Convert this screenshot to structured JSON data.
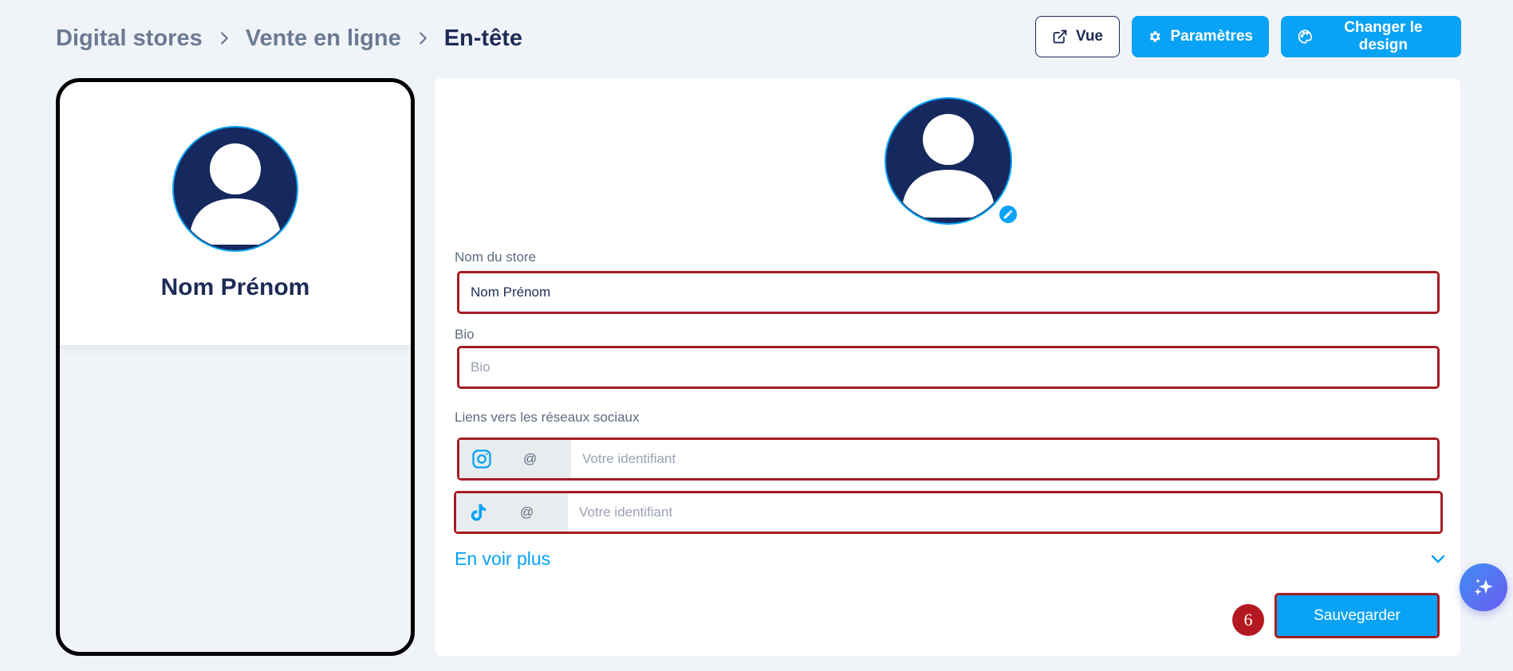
{
  "breadcrumb": {
    "items": [
      "Digital stores",
      "Vente en ligne",
      "En-tête"
    ]
  },
  "toolbar": {
    "view_label": "Vue",
    "settings_label": "Paramètres",
    "design_label": "Changer le design"
  },
  "preview": {
    "name": "Nom Prénom"
  },
  "form": {
    "store_name_label": "Nom du store",
    "store_name_value": "Nom Prénom",
    "bio_label": "Bio",
    "bio_placeholder": "Bio",
    "social_label": "Liens vers les réseaux sociaux",
    "social": [
      {
        "network": "instagram-icon",
        "prefix": "@",
        "placeholder": "Votre identifiant"
      },
      {
        "network": "tiktok-icon",
        "prefix": "@",
        "placeholder": "Votre identifiant"
      }
    ],
    "more_label": "En voir plus",
    "save_label": "Sauvegarder",
    "step_badge": "6"
  },
  "colors": {
    "accent": "#08a2f6",
    "navy": "#1d2b57",
    "highlight_border": "#a51d23"
  }
}
